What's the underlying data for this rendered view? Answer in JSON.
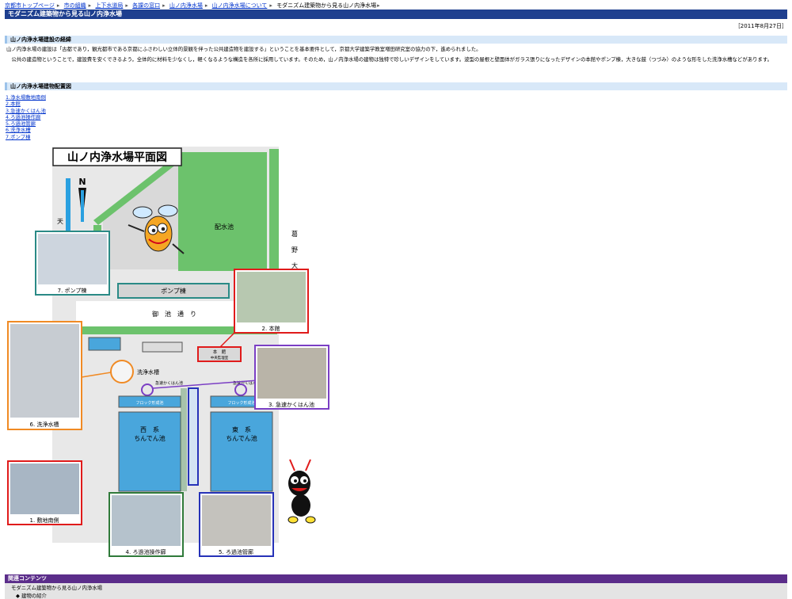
{
  "breadcrumb": [
    {
      "label": "京都市トップページ"
    },
    {
      "label": "市の組織"
    },
    {
      "label": "上下水道局"
    },
    {
      "label": "各課の窓口"
    },
    {
      "label": "山ノ内浄水場"
    },
    {
      "label": "山ノ内浄水場について"
    }
  ],
  "breadcrumb_current": "モダニズム建築物から見る山ノ内浄水場",
  "page_title": "モダニズム建築物から見る山ノ内浄水場",
  "date": "［2011年8月27日］",
  "section1": {
    "heading": "山ノ内浄水場建設の経緯",
    "p1": "山ノ内浄水場の建設は「古都であり，観光都市である京都にふさわしい立体的景観を伴った公共建造物を建設する」ということを基本要件として，京都大学建築学教室増田研究室の協力の下，進められました。",
    "p2": "　公共の建造物ということで，建設費を安くできるよう，全体的に材料を少なくし，軽くなるような構造を各所に採用しています。そのため，山ノ内浄水場の建物は独特で珍しいデザインをしています。波型の屋根と壁面体がガラス張りになったデザインの本館やポンプ棟，大きな鼓（つづみ）のような形をした洗浄水槽などがあります。"
  },
  "section2": {
    "heading": "山ノ内浄水場建物配置図",
    "links": [
      "1.浄水場敷地南側",
      "2.本館",
      "3.急速かくはん池",
      "4.ろ過池操作廊",
      "5.ろ過池管廊",
      "6.洗浄水槽",
      "7.ポンプ棟"
    ]
  },
  "map": {
    "title": "山ノ内浄水場平面図",
    "north": "N",
    "haisuichi": "配水池",
    "pump_building": "ポンプ棟",
    "road": "御　池　通　り",
    "honkan": "本　館",
    "chuo": "中央監理室",
    "senjo": "洗浄水槽",
    "kyusoku_left": "急速かくはん池",
    "kyusoku_right": "急速かくはん池",
    "floc_left": "フロック形成池",
    "floc_right": "フロック形成池",
    "west": "西　系",
    "east": "東　系",
    "chinden": "ちんでん池",
    "river_left": "天",
    "river_right": [
      "葛",
      "野",
      "大"
    ],
    "captions": {
      "c1": "1. 敷地南側",
      "c2": "2. 本館",
      "c3": "3. 急速かくはん池",
      "c4": "4. ろ過池操作廊",
      "c5": "5. ろ過池管廊",
      "c6": "6. 洗浄水槽",
      "c7": "7. ポンプ棟"
    },
    "colors": {
      "red": "#e01b1b",
      "orange": "#f08a24",
      "purple": "#7b3fc4",
      "teal": "#2a8a86",
      "green": "#2f7a3a",
      "blue": "#2632b8",
      "grass": "#6cc26c",
      "pool": "#49a6dc"
    }
  },
  "footer": {
    "heading": "関連コンテンツ",
    "item": "モダニズム建築物から見る山ノ内浄水場",
    "sub": "◆ 建物の紹介"
  }
}
